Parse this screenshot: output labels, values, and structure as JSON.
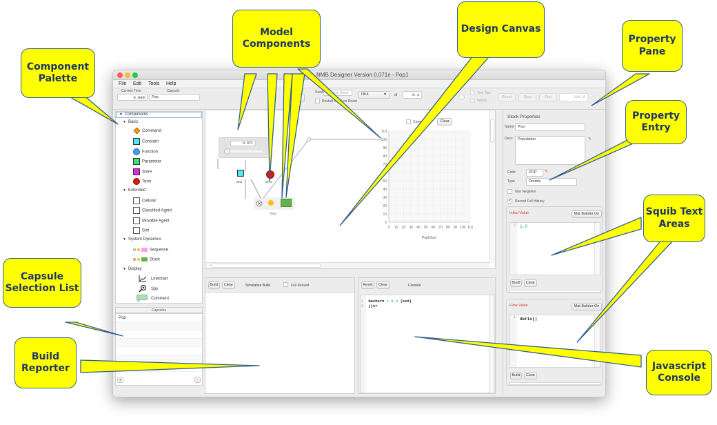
{
  "window": {
    "title": "NMB Designer Version 0.071e - Pop1",
    "menu": [
      "File",
      "Edit",
      "Tools",
      "Help"
    ]
  },
  "toolbar": {
    "current_time_label": "Current Time",
    "current_time_value": "0.000",
    "capsule_label": "Capsule",
    "capsule_value": "Pop",
    "seed_label": "Seed",
    "seed_placeholder": "Random Seed",
    "restart_reset_label": "Restart Rand on Reset",
    "integrator_value": "RK4",
    "dt_label": "dt",
    "dt_value": "0.1",
    "tooltips_label": "Tool Tips",
    "watch_label": "Watch",
    "reset_label": "Reset",
    "step_label": "Step",
    "run_label": "Run",
    "end_time_value": "200.0"
  },
  "palette": {
    "root": "Components",
    "groups": [
      {
        "label": "Basic",
        "items": [
          {
            "label": "Command",
            "icon": "command-diamond-icon",
            "color": "#f39c12"
          },
          {
            "label": "Constant",
            "icon": "constant-square-icon",
            "color": "#4fe8f0"
          },
          {
            "label": "Function",
            "icon": "function-circle-icon",
            "color": "#4a9df2"
          },
          {
            "label": "Parameter",
            "icon": "parameter-square-icon",
            "color": "#3ee07a"
          },
          {
            "label": "Store",
            "icon": "store-square-icon",
            "color": "#e625e6"
          },
          {
            "label": "Term",
            "icon": "term-circle-icon",
            "color": "#e0190c"
          }
        ]
      },
      {
        "label": "Extended",
        "items": [
          {
            "label": "Cellular",
            "icon": "empty-square-icon"
          },
          {
            "label": "Classified Agent",
            "icon": "empty-square-icon"
          },
          {
            "label": "Movable Agent",
            "icon": "empty-square-icon"
          },
          {
            "label": "Sim",
            "icon": "empty-square-icon"
          }
        ]
      },
      {
        "label": "System Dynamics",
        "items": [
          {
            "label": "Sequence",
            "icon": "sequence-flow-icon",
            "color": "#ff9cf2"
          },
          {
            "label": "Stock",
            "icon": "stock-flow-icon",
            "color": "#63b24a"
          }
        ]
      },
      {
        "label": "Display",
        "items": [
          {
            "label": "Linechart",
            "icon": "linechart-icon"
          },
          {
            "label": "Spy",
            "icon": "spy-magnifier-icon"
          },
          {
            "label": "Comment",
            "icon": "comment-bubble-icon"
          }
        ]
      }
    ]
  },
  "capsules": {
    "header": "Capsules",
    "items": [
      "Pop"
    ],
    "add_label": "+",
    "remove_label": "-"
  },
  "canvas": {
    "slider_value": "0.071",
    "slider_fraction": 0.07,
    "nodes": {
      "rand": "rand",
      "deriv": "deriv",
      "pop": "Pop"
    },
    "chart": {
      "compare_label": "Compare",
      "clear_label": "Clear",
      "caption": "PopChart"
    }
  },
  "chart_data": {
    "type": "line",
    "title": "PopChart",
    "xlabel": "",
    "ylabel": "",
    "x_ticks": [
      0,
      10,
      20,
      30,
      40,
      50,
      60,
      70,
      80,
      90,
      100,
      110
    ],
    "y_ticks": [
      0,
      10,
      20,
      30,
      40,
      50,
      60,
      70,
      80,
      90,
      100,
      110
    ],
    "xlim": [
      0,
      110
    ],
    "ylim": [
      0,
      110
    ],
    "grid": true,
    "series": []
  },
  "build": {
    "build_label": "Build",
    "clear_label": "Clear",
    "title": "Simulation Build",
    "full_rebuild_label": "Full Rebuild"
  },
  "console": {
    "reset_label": "Reset",
    "clear_label": "Clear",
    "title": "Console",
    "lines": [
      {
        "num": "1",
        "a": "Nashorn",
        "b": "1.8.0",
        "c": "(es6)"
      },
      {
        "num": "2",
        "a": "jjs>",
        "b": "",
        "c": ""
      }
    ]
  },
  "properties": {
    "title": "Stock Properties",
    "name_label": "Name:",
    "name_value": "Pop",
    "desc_label": "Desc:",
    "desc_value": "Population",
    "code_label": "Code",
    "code_value": "POP",
    "type_label": "Type",
    "type_value": "Double",
    "non_negative_label": "Non Negative",
    "non_negative_checked": false,
    "record_history_label": "Record Full History",
    "record_history_checked": true,
    "initial": {
      "label": "Initial Value",
      "mat_label": "Mat Builder On",
      "line_num": "1",
      "code": "1.0",
      "build_label": "Build",
      "clear_label": "Clear"
    },
    "flow": {
      "label": "Flow Value",
      "mat_label": "Mat Builder On",
      "line_num": "1",
      "code": "deriv()",
      "build_label": "Build",
      "clear_label": "Clear"
    }
  },
  "callouts": {
    "component_palette": "Component Palette",
    "model_components": "Model Components",
    "design_canvas": "Design Canvas",
    "property_pane": "Property Pane",
    "property_entry": "Property Entry",
    "squib_text_areas": "Squib Text Areas",
    "capsule_selection_list": "Capsule Selection List",
    "build_reporter": "Build Reporter",
    "javascript_console": "Javascript Console"
  },
  "colors": {
    "callout_fill": "#ffff00",
    "callout_border": "#355e8f",
    "callout_text": "#1f3864",
    "squib_label": "#e0342d"
  }
}
